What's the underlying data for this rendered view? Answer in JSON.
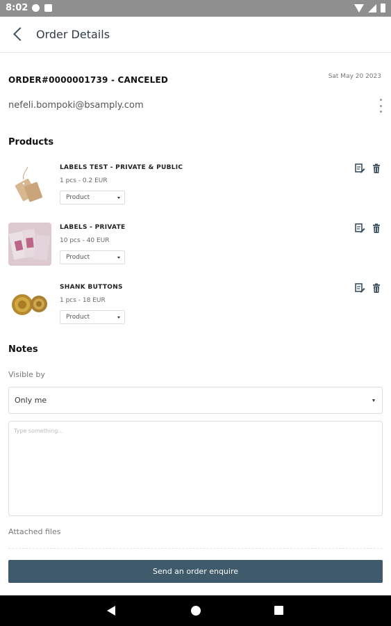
{
  "status_bar": {
    "time": "8:02"
  },
  "app_bar": {
    "title": "Order Details"
  },
  "order": {
    "id_status": "ORDER#0000001739 - CANCELED",
    "date": "Sat May 20 2023",
    "email": "nefeli.bompoki@bsamply.com"
  },
  "products_section": {
    "title": "Products",
    "items": [
      {
        "name": "LABELS TEST - PRIVATE & PUBLIC",
        "quantity_price": "1 pcs - 0.2 EUR",
        "type": "Product",
        "image": "hang-tag-image"
      },
      {
        "name": "LABELS - PRIVATE",
        "quantity_price": "10 pcs - 40 EUR",
        "type": "Product",
        "image": "woven-labels-image"
      },
      {
        "name": "SHANK BUTTONS",
        "quantity_price": "1 pcs - 18 EUR",
        "type": "Product",
        "image": "gold-buttons-image"
      }
    ]
  },
  "notes_section": {
    "title": "Notes",
    "visible_by_label": "Visible by",
    "visible_by_value": "Only me",
    "placeholder": "Type something...",
    "attached_files_label": "Attached files"
  },
  "send_button": {
    "label": "Send an order enquire"
  },
  "colors": {
    "primary": "#3e5a6b",
    "status_bar": "#8f8f8f",
    "icon": "#3a4f60"
  }
}
